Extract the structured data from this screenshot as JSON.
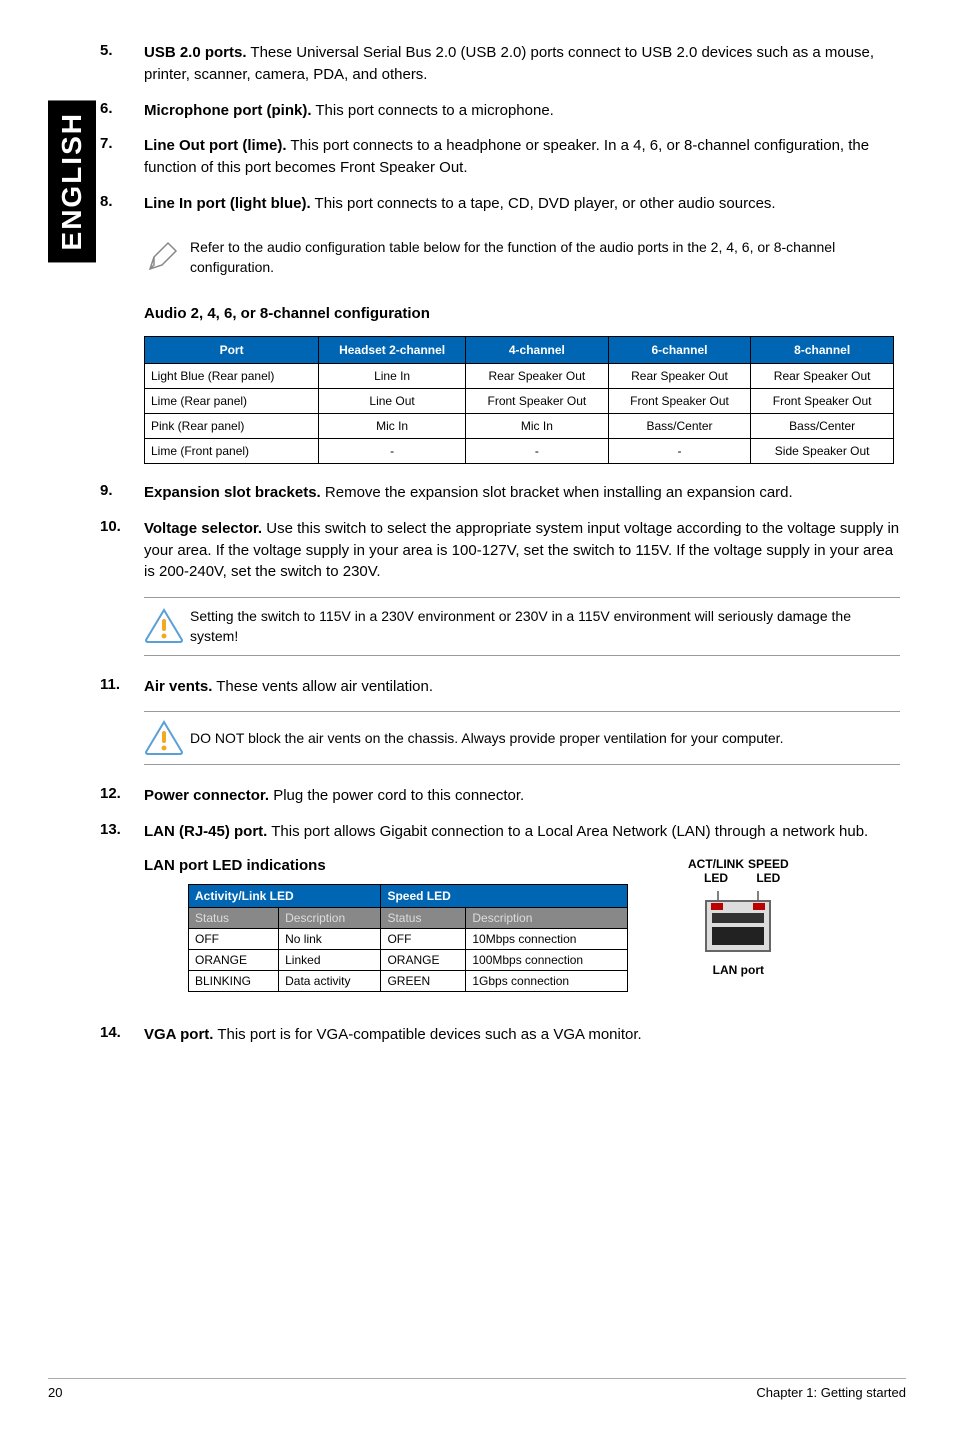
{
  "side_tab": "ENGLISH",
  "items": {
    "n5": {
      "num": "5.",
      "bold": "USB 2.0 ports.",
      "text": " These Universal Serial Bus 2.0 (USB 2.0) ports connect to USB 2.0 devices such as a mouse, printer, scanner, camera, PDA, and others."
    },
    "n6": {
      "num": "6.",
      "bold": "Microphone port (pink).",
      "text": " This port connects to a microphone."
    },
    "n7": {
      "num": "7.",
      "bold": "Line Out port (lime).",
      "text": " This port connects to a headphone or speaker. In a 4, 6, or 8-channel configuration, the function of this port becomes Front Speaker Out."
    },
    "n8": {
      "num": "8.",
      "bold": "Line In port (light blue).",
      "text": " This port connects to a tape, CD, DVD player, or other audio sources."
    },
    "n9": {
      "num": "9.",
      "bold": "Expansion slot brackets.",
      "text": " Remove the expansion slot bracket when installing an expansion card."
    },
    "n10": {
      "num": "10.",
      "bold": "Voltage selector.",
      "text": " Use this switch to select the appropriate system input voltage according to the voltage supply in your area. If the voltage supply in your area is 100-127V, set the switch to 115V. If the voltage supply in your area is 200-240V, set the switch to 230V."
    },
    "n11": {
      "num": "11.",
      "bold": "Air vents.",
      "text": " These vents allow air ventilation."
    },
    "n12": {
      "num": "12.",
      "bold": "Power connector.",
      "text": " Plug the power cord to this connector."
    },
    "n13": {
      "num": "13.",
      "bold": "LAN (RJ-45) port.",
      "text": " This port allows Gigabit connection to a Local Area Network (LAN) through a network hub."
    },
    "n14": {
      "num": "14.",
      "bold": "VGA port.",
      "text": " This port is for VGA-compatible devices such as a VGA monitor."
    }
  },
  "notes": {
    "audio_note": "Refer to the audio configuration table below for the function of the audio ports in the 2, 4, 6, or 8-channel configuration.",
    "voltage_warn": "Setting the switch to 115V in a 230V environment or 230V in a 115V environment will seriously damage the system!",
    "vent_warn": "DO NOT block the air vents on the chassis. Always provide proper ventilation for your computer."
  },
  "audio_section_title": "Audio 2, 4, 6, or 8-channel configuration",
  "audio_table": {
    "headers": [
      "Port",
      "Headset 2-channel",
      "4-channel",
      "6-channel",
      "8-channel"
    ],
    "rows": [
      [
        "Light Blue (Rear panel)",
        "Line In",
        "Rear Speaker Out",
        "Rear Speaker Out",
        "Rear Speaker Out"
      ],
      [
        "Lime (Rear panel)",
        "Line Out",
        "Front Speaker Out",
        "Front Speaker Out",
        "Front Speaker Out"
      ],
      [
        "Pink (Rear panel)",
        "Mic In",
        "Mic In",
        "Bass/Center",
        "Bass/Center"
      ],
      [
        "Lime (Front panel)",
        "-",
        "-",
        "-",
        "Side Speaker Out"
      ]
    ]
  },
  "lan_section_title": "LAN port LED indications",
  "lan_table": {
    "group_headers": [
      "Activity/Link LED",
      "Speed LED"
    ],
    "sub_headers": [
      "Status",
      "Description",
      "Status",
      "Description"
    ],
    "rows": [
      [
        "OFF",
        "No link",
        "OFF",
        "10Mbps connection"
      ],
      [
        "ORANGE",
        "Linked",
        "ORANGE",
        "100Mbps connection"
      ],
      [
        "BLINKING",
        "Data activity",
        "GREEN",
        "1Gbps connection"
      ]
    ]
  },
  "lan_diagram": {
    "label1a": "ACT/LINK",
    "label1b": "LED",
    "label2a": "SPEED",
    "label2b": "LED",
    "caption": "LAN port"
  },
  "footer": {
    "page": "20",
    "chapter": "Chapter 1: Getting started"
  }
}
